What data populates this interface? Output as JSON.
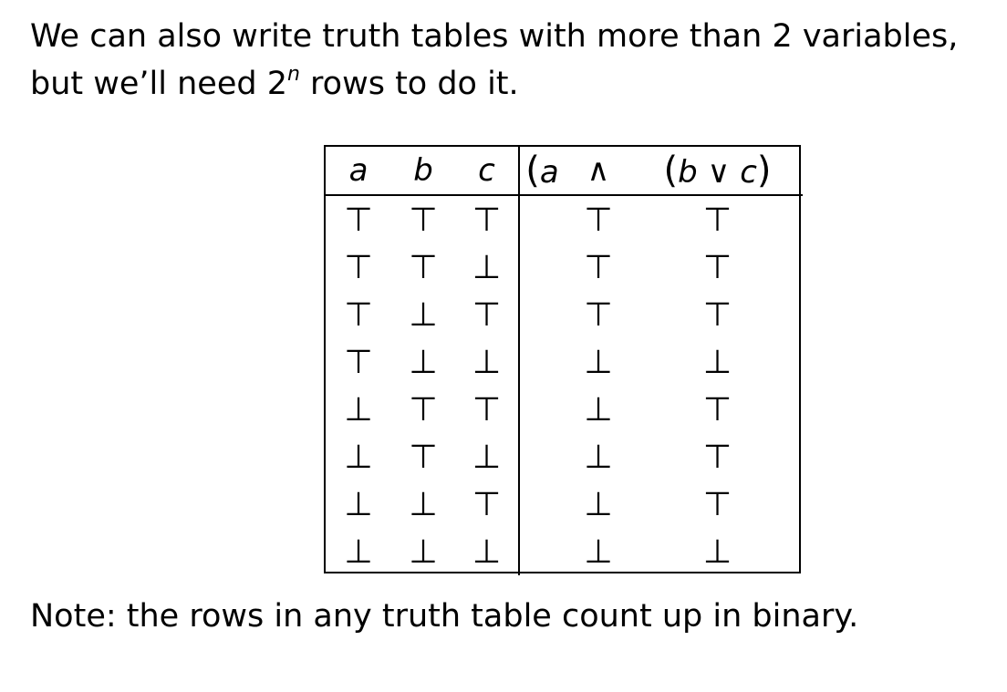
{
  "intro": {
    "line1": "We can also write truth tables with more than 2 variables,",
    "line2_before": "but we’ll need 2",
    "line2_sup": "n",
    "line2_after": " rows to do it."
  },
  "table": {
    "headers": {
      "a": "a",
      "b": "b",
      "c": "c",
      "expr_open": "(",
      "expr_a": "a",
      "expr_and": "∧",
      "expr_paren_open": "(",
      "expr_b": "b",
      "expr_or": "∨",
      "expr_c": "c",
      "expr_paren_close": ")"
    },
    "rows": [
      {
        "a": "⊤",
        "b": "⊤",
        "c": "⊤",
        "and": "⊤",
        "or": "⊤"
      },
      {
        "a": "⊤",
        "b": "⊤",
        "c": "⊥",
        "and": "⊤",
        "or": "⊤"
      },
      {
        "a": "⊤",
        "b": "⊥",
        "c": "⊤",
        "and": "⊤",
        "or": "⊤"
      },
      {
        "a": "⊤",
        "b": "⊥",
        "c": "⊥",
        "and": "⊥",
        "or": "⊥"
      },
      {
        "a": "⊥",
        "b": "⊤",
        "c": "⊤",
        "and": "⊥",
        "or": "⊤"
      },
      {
        "a": "⊥",
        "b": "⊤",
        "c": "⊥",
        "and": "⊥",
        "or": "⊤"
      },
      {
        "a": "⊥",
        "b": "⊥",
        "c": "⊤",
        "and": "⊥",
        "or": "⊤"
      },
      {
        "a": "⊥",
        "b": "⊥",
        "c": "⊥",
        "and": "⊥",
        "or": "⊥"
      }
    ]
  },
  "note": "Note: the rows in any truth table count up in binary."
}
